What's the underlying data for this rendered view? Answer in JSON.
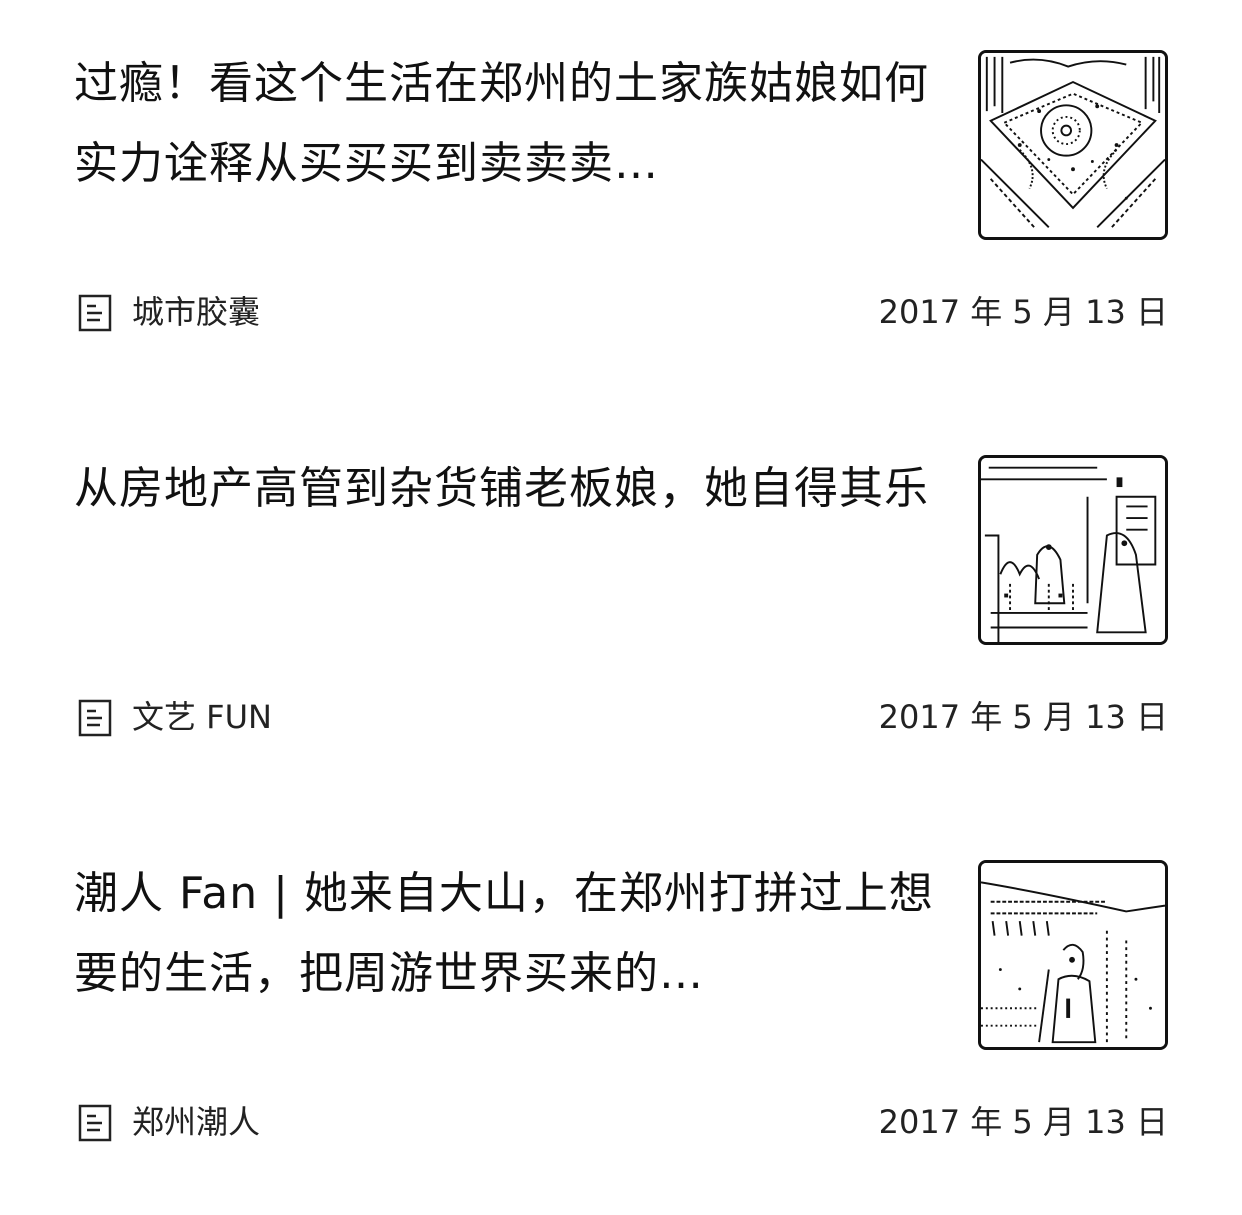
{
  "articles": [
    {
      "title": "过瘾！看这个生活在郑州的土家族姑娘如何实力诠释从买买买到卖卖卖…",
      "source": "城市胶囊",
      "date": "2017 年 5 月 13 日",
      "thumbnail": "embroidered-textile-photo",
      "icon": "document-icon"
    },
    {
      "title": "从房地产高管到杂货铺老板娘，她自得其乐",
      "source": "文艺 FUN",
      "date": "2017 年 5 月 13 日",
      "thumbnail": "shop-interior-photo",
      "icon": "document-icon"
    },
    {
      "title": "潮人 Fan | 她来自大山，在郑州打拼过上想要的生活，把周游世界买来的…",
      "source": "郑州潮人",
      "date": "2017 年 5 月 13 日",
      "thumbnail": "street-portrait-photo",
      "icon": "document-icon"
    }
  ]
}
